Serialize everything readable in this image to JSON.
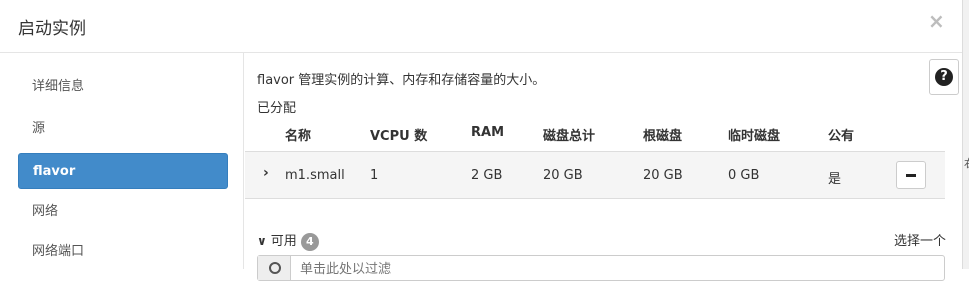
{
  "dialog": {
    "title": "启动实例",
    "close_glyph": "×"
  },
  "edge": {
    "fragment": "右"
  },
  "sidebar": {
    "items": [
      {
        "label": "详细信息",
        "active": false
      },
      {
        "label": "源",
        "active": false
      },
      {
        "label": "flavor",
        "active": true
      },
      {
        "label": "网络",
        "active": false
      },
      {
        "label": "网络端口",
        "active": false
      }
    ]
  },
  "main": {
    "description": "flavor 管理实例的计算、内存和存储容量的大小。",
    "help_glyph": "?",
    "allocated": {
      "label": "已分配",
      "columns": [
        "名称",
        "VCPU 数",
        "RAM",
        "磁盘总计",
        "根磁盘",
        "临时磁盘",
        "公有"
      ],
      "rows": [
        {
          "name": "m1.small",
          "vcpu": "1",
          "ram": "2 GB",
          "disk_total": "20 GB",
          "root_disk": "20 GB",
          "ephemeral_disk": "0 GB",
          "public": "是"
        }
      ]
    },
    "available": {
      "label": "可用",
      "count": "4",
      "choose_label": "选择一个",
      "filter_placeholder": "单击此处以过滤"
    }
  },
  "colors": {
    "active_nav": "#428bca",
    "badge": "#999999"
  },
  "icons": {
    "expand": "chevron-right-icon",
    "remove": "minus-icon",
    "help": "question-icon",
    "search": "search-icon"
  }
}
